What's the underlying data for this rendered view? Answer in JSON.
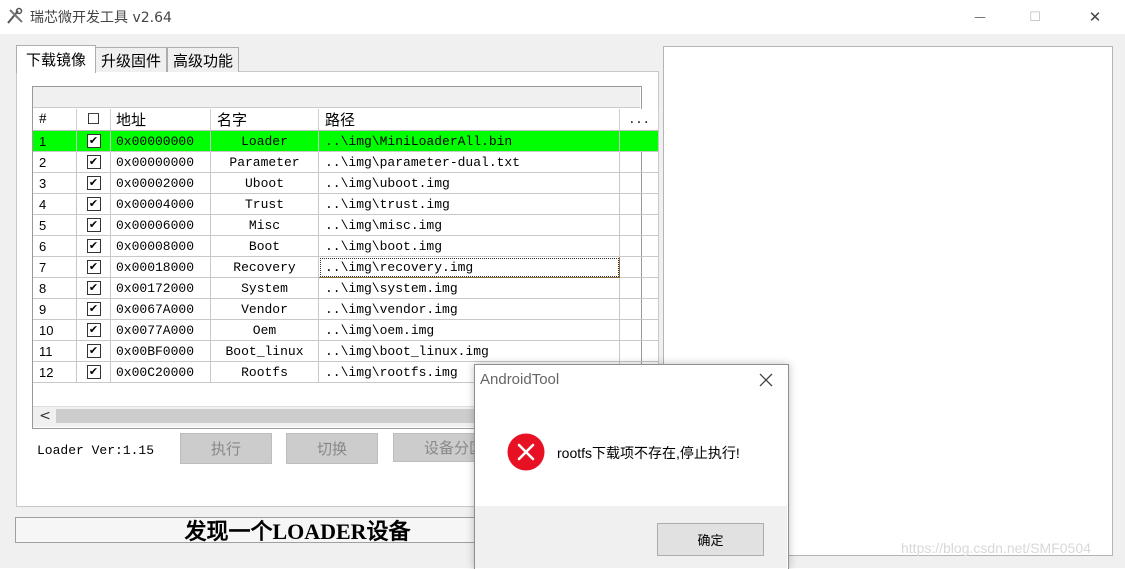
{
  "window": {
    "title": "瑞芯微开发工具 v2.64",
    "min_glyph": "—",
    "max_glyph": "☐",
    "close_glyph": "✕"
  },
  "tabs": [
    {
      "label": "下载镜像",
      "active": true
    },
    {
      "label": "升级固件",
      "active": false
    },
    {
      "label": "高级功能",
      "active": false
    }
  ],
  "table": {
    "headers": {
      "idx": "#",
      "check": "☐",
      "address": "地址",
      "name": "名字",
      "path": "路径",
      "more": "..."
    },
    "rows": [
      {
        "idx": "1",
        "checked": true,
        "address": "0x00000000",
        "name": "Loader",
        "path": "..\\img\\MiniLoaderAll.bin",
        "highlight": true
      },
      {
        "idx": "2",
        "checked": true,
        "address": "0x00000000",
        "name": "Parameter",
        "path": "..\\img\\parameter-dual.txt"
      },
      {
        "idx": "3",
        "checked": true,
        "address": "0x00002000",
        "name": "Uboot",
        "path": "..\\img\\uboot.img"
      },
      {
        "idx": "4",
        "checked": true,
        "address": "0x00004000",
        "name": "Trust",
        "path": "..\\img\\trust.img"
      },
      {
        "idx": "5",
        "checked": true,
        "address": "0x00006000",
        "name": "Misc",
        "path": "..\\img\\misc.img"
      },
      {
        "idx": "6",
        "checked": true,
        "address": "0x00008000",
        "name": "Boot",
        "path": "..\\img\\boot.img"
      },
      {
        "idx": "7",
        "checked": true,
        "address": "0x00018000",
        "name": "Recovery",
        "path": "..\\img\\recovery.img",
        "focused": true
      },
      {
        "idx": "8",
        "checked": true,
        "address": "0x00172000",
        "name": "System",
        "path": "..\\img\\system.img"
      },
      {
        "idx": "9",
        "checked": true,
        "address": "0x0067A000",
        "name": "Vendor",
        "path": "..\\img\\vendor.img"
      },
      {
        "idx": "10",
        "checked": true,
        "address": "0x0077A000",
        "name": "Oem",
        "path": "..\\img\\oem.img"
      },
      {
        "idx": "11",
        "checked": true,
        "address": "0x00BF0000",
        "name": "Boot_linux",
        "path": "..\\img\\boot_linux.img"
      },
      {
        "idx": "12",
        "checked": true,
        "address": "0x00C20000",
        "name": "Rootfs",
        "path": "..\\img\\rootfs.img"
      }
    ],
    "check_glyph": "✔",
    "highlight_color": "#00ff00"
  },
  "scroll": {
    "left_glyph": "<"
  },
  "bottom": {
    "loader_version": "Loader Ver:1.15",
    "run_label": "执行",
    "switch_label": "切换",
    "device_label": "设备分区"
  },
  "status": {
    "text": "发现一个LOADER设备"
  },
  "watermark": {
    "text": "https://blog.csdn.net/SMF0504"
  },
  "dialog": {
    "title": "AndroidTool",
    "message": "rootfs下载项不存在,停止执行!",
    "ok_label": "确定",
    "error_color": "#e81123"
  }
}
